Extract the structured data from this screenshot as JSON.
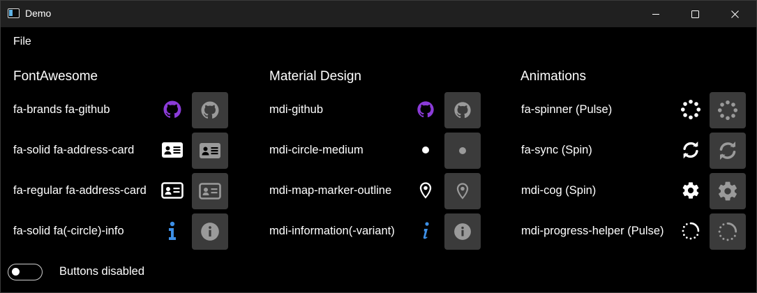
{
  "window": {
    "title": "Demo"
  },
  "menu": {
    "file": "File"
  },
  "colors": {
    "github_purple": "#8b3bd8",
    "info_blue": "#3d8fe6",
    "button_bg": "#3b3b3b",
    "disabled_glyph": "#9a9a9a"
  },
  "columns": {
    "fontawesome": {
      "title": "FontAwesome",
      "rows": [
        {
          "label": "fa-brands fa-github",
          "icon": "github-icon"
        },
        {
          "label": "fa-solid fa-address-card",
          "icon": "address-card-solid-icon"
        },
        {
          "label": "fa-regular fa-address-card",
          "icon": "address-card-regular-icon"
        },
        {
          "label": "fa-solid fa(-circle)-info",
          "icon": "info-icon"
        }
      ]
    },
    "material": {
      "title": "Material Design",
      "rows": [
        {
          "label": "mdi-github",
          "icon": "github-icon"
        },
        {
          "label": "mdi-circle-medium",
          "icon": "circle-medium-icon"
        },
        {
          "label": "mdi-map-marker-outline",
          "icon": "map-marker-outline-icon"
        },
        {
          "label": "mdi-information(-variant)",
          "icon": "information-variant-icon"
        }
      ]
    },
    "animations": {
      "title": "Animations",
      "rows": [
        {
          "label": "fa-spinner (Pulse)",
          "icon": "spinner-icon"
        },
        {
          "label": "fa-sync (Spin)",
          "icon": "sync-icon"
        },
        {
          "label": "mdi-cog (Spin)",
          "icon": "cog-icon"
        },
        {
          "label": "mdi-progress-helper (Pulse)",
          "icon": "progress-helper-icon"
        }
      ]
    }
  },
  "toggle": {
    "label": "Buttons disabled",
    "checked": false
  }
}
